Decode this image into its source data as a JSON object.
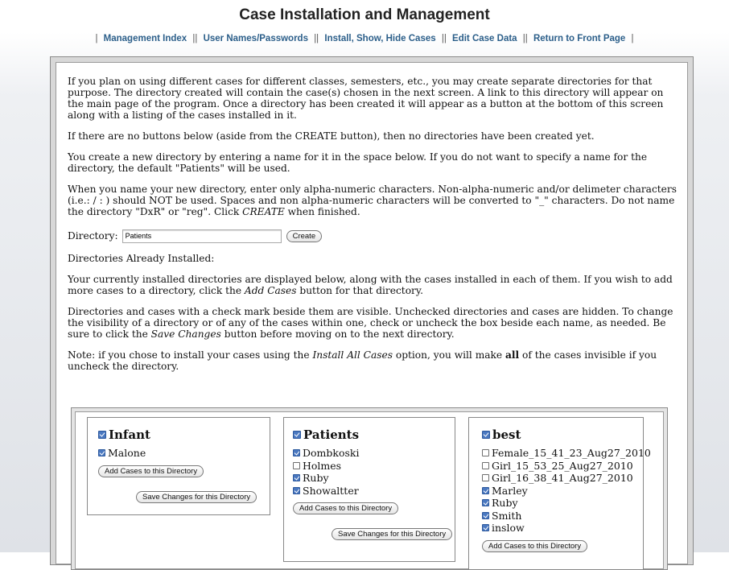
{
  "page": {
    "title": "Case Installation and Management"
  },
  "nav": {
    "items": [
      "Management Index",
      "User Names/Passwords",
      "Install, Show, Hide Cases",
      "Edit Case Data",
      "Return to Front Page"
    ]
  },
  "intro": {
    "p1": "If you plan on using different cases for different classes, semesters, etc., you may create separate directories for that purpose. The directory created will contain the case(s) chosen in the next screen. A link to this directory will appear on the main page of the program. Once a directory has been created it will appear as a button at the bottom of this screen along with a listing of the cases installed in it.",
    "p2": "If there are no buttons below (aside from the CREATE button), then no directories have been created yet.",
    "p3": "You create a new directory by entering a name for it in the space below. If you do not want to specify a name for the directory, the default \"Patients\" will be used.",
    "p4a": "When you name your new directory, enter only alpha-numeric characters. Non-alpha-numeric and/or delimeter characters (i.e.: / : ) should NOT be used. Spaces and non alpha-numeric characters will be converted to \"_\" characters. Do not name the directory \"DxR\" or \"reg\". Click ",
    "p4_em": "CREATE",
    "p4b": " when finished."
  },
  "directory_form": {
    "label": "Directory:",
    "value": "Patients",
    "create_label": "Create"
  },
  "installed": {
    "heading": "Directories Already Installed:",
    "p1a": "Your currently installed directories are displayed below, along with the cases installed in each of them. If you wish to add more cases to a directory, click the ",
    "p1_em": "Add Cases",
    "p1b": " button for that directory.",
    "p2a": "Directories and cases with a check mark beside them are visible. Unchecked directories and cases are hidden. To change the visibility of a directory or of any of the cases within one, check or uncheck the box beside each name, as needed. Be sure to click the ",
    "p2_em": "Save Changes",
    "p2b": " button before moving on to the next directory.",
    "p3a": "Note: if you chose to install your cases using the ",
    "p3_em": "Install All Cases",
    "p3b": " option, you will make ",
    "p3_bold": "all",
    "p3c": " of the cases invisible if you uncheck the directory."
  },
  "directories": [
    {
      "name": "Infant",
      "checked": true,
      "cases": [
        {
          "name": "Malone",
          "checked": true
        }
      ],
      "add_label": "Add Cases to this Directory",
      "save_label": "Save Changes for this Directory"
    },
    {
      "name": "Patients",
      "checked": true,
      "cases": [
        {
          "name": "Dombkoski",
          "checked": true
        },
        {
          "name": "Holmes",
          "checked": false
        },
        {
          "name": "Ruby",
          "checked": true
        },
        {
          "name": "Showaltter",
          "checked": true
        }
      ],
      "add_label": "Add Cases to this Directory",
      "save_label": "Save Changes for this Directory"
    },
    {
      "name": "best",
      "checked": true,
      "cases": [
        {
          "name": "Female_15_41_23_Aug27_2010",
          "checked": false
        },
        {
          "name": "Girl_15_53_25_Aug27_2010",
          "checked": false
        },
        {
          "name": "Girl_16_38_41_Aug27_2010",
          "checked": false
        },
        {
          "name": "Marley",
          "checked": true
        },
        {
          "name": "Ruby",
          "checked": true
        },
        {
          "name": "Smith",
          "checked": true
        },
        {
          "name": "inslow",
          "checked": true
        }
      ],
      "add_label": "Add Cases to this Directory"
    }
  ]
}
